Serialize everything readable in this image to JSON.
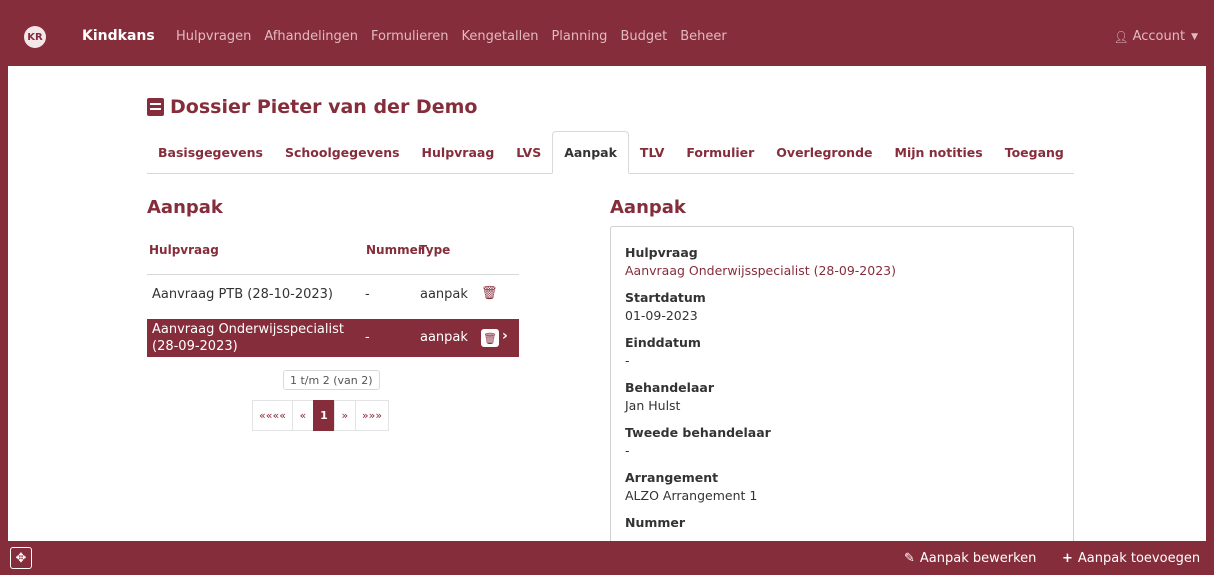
{
  "nav": {
    "logo_text": "KR",
    "brand": "Kindkans",
    "items": [
      "Hulpvragen",
      "Afhandelingen",
      "Formulieren",
      "Kengetallen",
      "Planning",
      "Budget",
      "Beheer"
    ],
    "account": "Account"
  },
  "page": {
    "title": "Dossier Pieter van der Demo"
  },
  "tabs": [
    "Basisgegevens",
    "Schoolgegevens",
    "Hulpvraag",
    "LVS",
    "Aanpak",
    "TLV",
    "Formulier",
    "Overlegronde",
    "Mijn notities",
    "Toegang"
  ],
  "active_tab": "Aanpak",
  "left": {
    "heading": "Aanpak",
    "columns": [
      "Hulpvraag",
      "Nummer",
      "Type"
    ],
    "rows": [
      {
        "hulpvraag": "Aanvraag PTB (28-10-2023)",
        "nummer": "-",
        "type": "aanpak",
        "selected": false
      },
      {
        "hulpvraag_line1": "Aanvraag Onderwijsspecialist",
        "hulpvraag_line2": "(28-09-2023)",
        "nummer": "-",
        "type": "aanpak",
        "selected": true
      }
    ],
    "pager_info": "1 t/m 2 (van 2)",
    "pager": {
      "first": "««««",
      "prev": "«",
      "current": "1",
      "next": "»",
      "last": "»»»"
    }
  },
  "right": {
    "heading": "Aanpak",
    "fields": [
      {
        "label": "Hulpvraag",
        "value": "Aanvraag Onderwijsspecialist (28-09-2023)"
      },
      {
        "label": "Startdatum",
        "value": "01-09-2023"
      },
      {
        "label": "Einddatum",
        "value": "-"
      },
      {
        "label": "Behandelaar",
        "value": "Jan Hulst"
      },
      {
        "label": "Tweede behandelaar",
        "value": "-"
      },
      {
        "label": "Arrangement",
        "value": "ALZO Arrangement 1"
      },
      {
        "label": "Nummer",
        "value": "-"
      }
    ]
  },
  "bottom": {
    "edit_label": "Aanpak bewerken",
    "add_label": "Aanpak toevoegen"
  },
  "colors": {
    "brand": "#862d3b"
  },
  "icons": [
    "user-icon",
    "document-icon",
    "trash-icon",
    "chevron-right-icon",
    "pencil-icon",
    "plus-icon",
    "move-icon"
  ]
}
